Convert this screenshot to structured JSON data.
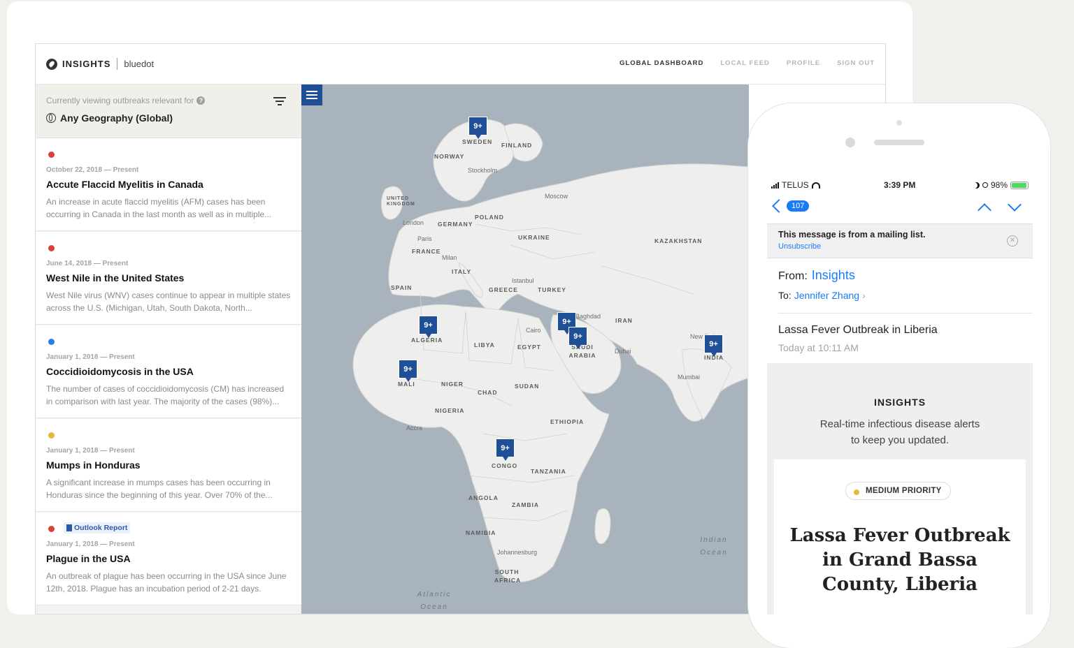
{
  "app": {
    "brand": "INSIGHTS",
    "sub_brand": "bluedot",
    "nav": [
      "GLOBAL DASHBOARD",
      "LOCAL FEED",
      "PROFILE",
      "SIGN OUT"
    ]
  },
  "sidebar": {
    "filter_caption": "Currently viewing outbreaks relevant for",
    "filter_value": "Any Geography (Global)",
    "items": [
      {
        "dot_color": "#d9403a",
        "date": "October 22, 2018 — Present",
        "title": "Accute Flaccid Myelitis in Canada",
        "desc": "An increase in acute flaccid myelitis (AFM) cases has been occurring in Canada in the last month as well as in multiple..."
      },
      {
        "dot_color": "#d9403a",
        "date": "June 14, 2018 — Present",
        "title": "West Nile in the United States",
        "desc": "West Nile virus (WNV) cases continue to appear in multiple states across the U.S. (Michigan, Utah, South Dakota, North..."
      },
      {
        "dot_color": "#2f7ce8",
        "date": "January 1, 2018 — Present",
        "title": "Coccidioidomycosis in the USA",
        "desc": "The number of cases of coccidioidomycosis (CM) has increased in comparison with last year. The majority of the cases (98%)..."
      },
      {
        "dot_color": "#e6b93c",
        "date": "January 1, 2018 — Present",
        "title": "Mumps in Honduras",
        "desc": "A significant increase in mumps cases has been occurring in Honduras since the beginning of this year. Over 70% of the..."
      },
      {
        "dot_color": "#d9403a",
        "badge": "Outlook Report",
        "date": "January 1, 2018 — Present",
        "title": "Plague in the USA",
        "desc": "An outbreak of plague has been occurring in the USA since June 12th, 2018. Plague has an incubation period of 2-21 days."
      }
    ]
  },
  "map": {
    "marker_label": "9+",
    "countries": [
      "NORWAY",
      "SWEDEN",
      "FINLAND",
      "UNITED KINGDOM",
      "POLAND",
      "GERMANY",
      "FRANCE",
      "UKRAINE",
      "KAZAKHSTAN",
      "ITALY",
      "SPAIN",
      "GREECE",
      "TURKEY",
      "IRAN",
      "ALGERIA",
      "LIBYA",
      "EGYPT",
      "SAUDI ARABIA",
      "INDIA",
      "MALI",
      "NIGER",
      "CHAD",
      "SUDAN",
      "NIGERIA",
      "ETHIOPIA",
      "CONGO",
      "TANZANIA",
      "ANGOLA",
      "ZAMBIA",
      "NAMIBIA",
      "SOUTH AFRICA"
    ],
    "cities": [
      "Stockholm",
      "Moscow",
      "London",
      "Paris",
      "Milan",
      "Istanbul",
      "Baghdad",
      "Cairo",
      "Dubai",
      "New Delhi",
      "Mumbai",
      "Accra",
      "Johannesburg"
    ],
    "oceans": [
      "Atlantic Ocean",
      "Indian Ocean"
    ]
  },
  "phone": {
    "carrier": "TELUS",
    "time": "3:39 PM",
    "battery": "98%",
    "unread_count": "107",
    "mailing_list_notice": "This message is from a mailing list.",
    "unsubscribe": "Unsubscribe",
    "from_label": "From:",
    "from_value": "Insights",
    "to_label": "To:",
    "to_value": "Jennifer Zhang",
    "subject": "Lassa Fever Outbreak in Liberia",
    "sent": "Today at 10:11 AM",
    "body_brand": "INSIGHTS",
    "body_tagline": "Real-time infectious disease alerts to keep you updated.",
    "priority": "MEDIUM PRIORITY",
    "priority_color": "#e5b93a",
    "headline": "Lassa Fever Outbreak in Grand Bassa County, Liberia"
  }
}
